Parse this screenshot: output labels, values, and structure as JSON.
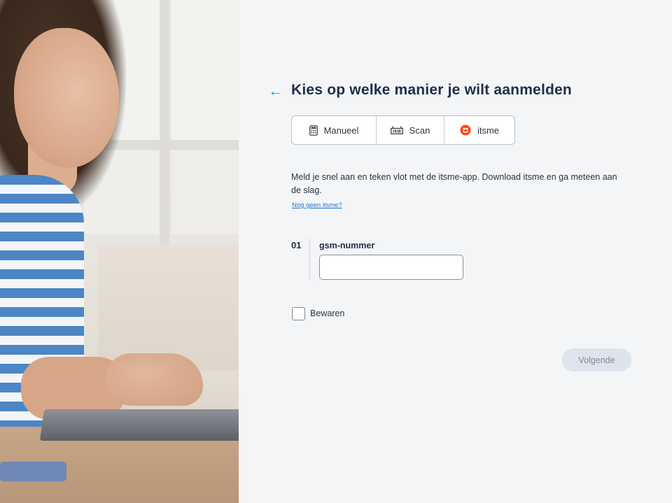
{
  "page": {
    "back_icon": "arrow-left-icon",
    "title": "Kies op welke manier je wilt aanmelden"
  },
  "tabs": [
    {
      "label": "Manueel",
      "icon": "calculator-icon"
    },
    {
      "label": "Scan",
      "icon": "scanner-icon"
    },
    {
      "label": "itsme",
      "icon": "itsme-logo-icon"
    }
  ],
  "intro": {
    "text": "Meld je snel aan en teken vlot met de itsme-app. Download itsme en ga meteen aan de slag.",
    "link": "Nog geen itsme?"
  },
  "form": {
    "step_number": "01",
    "phone_label": "gsm-nummer",
    "phone_value": "",
    "remember_label": "Bewaren",
    "remember_checked": false,
    "next_label": "Volgende"
  },
  "colors": {
    "accent": "#2a9fd6",
    "title": "#1d2f4a",
    "link": "#1f76c8",
    "itsme_brand": "#ff4612",
    "button_disabled_bg": "#dde4eb",
    "button_disabled_text": "#7d8a98"
  }
}
